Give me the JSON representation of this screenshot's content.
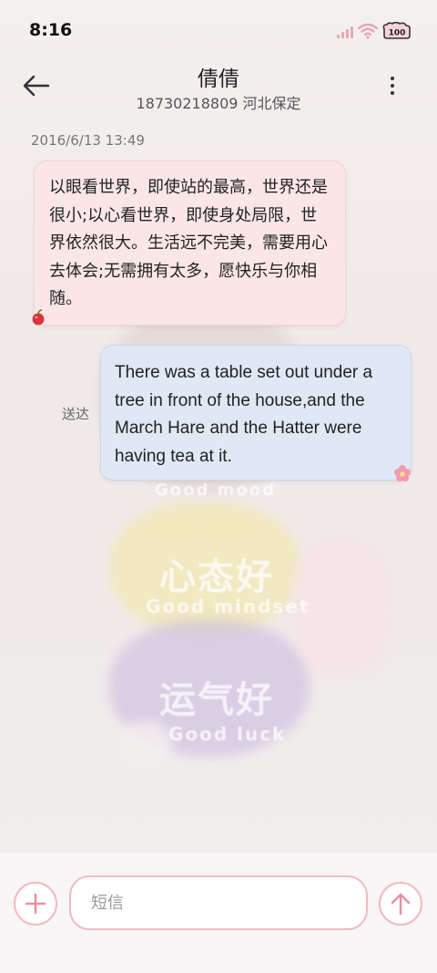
{
  "status_bar": {
    "time": "8:16",
    "battery_label": "100"
  },
  "header": {
    "contact_name": "倩倩",
    "contact_detail": "18730218809 河北保定"
  },
  "conversation": {
    "date_label": "2016/6/13 13:49",
    "incoming_message": "以眼看世界，即使站的最高，世界还是很小;以心看世界，即使身处局限，世界依然很大。生活远不完美，需要用心去体会;无需拥有太多，愿快乐与你相随。",
    "outgoing_message": "There was a table set out under a tree in front of the house,and the March Hare and the Hatter were having tea at it.",
    "delivery_status": "送达"
  },
  "composer": {
    "placeholder": "短信"
  },
  "background": {
    "text_1": "心态好",
    "text_2": "Good mindset",
    "text_3": "运气好",
    "text_4": "Good luck",
    "text_5": "Good mood"
  },
  "colors": {
    "accent_pink": "#f2b9c4",
    "incoming_bubble": "#fbe6e7",
    "outgoing_bubble": "#dfe8f5"
  }
}
